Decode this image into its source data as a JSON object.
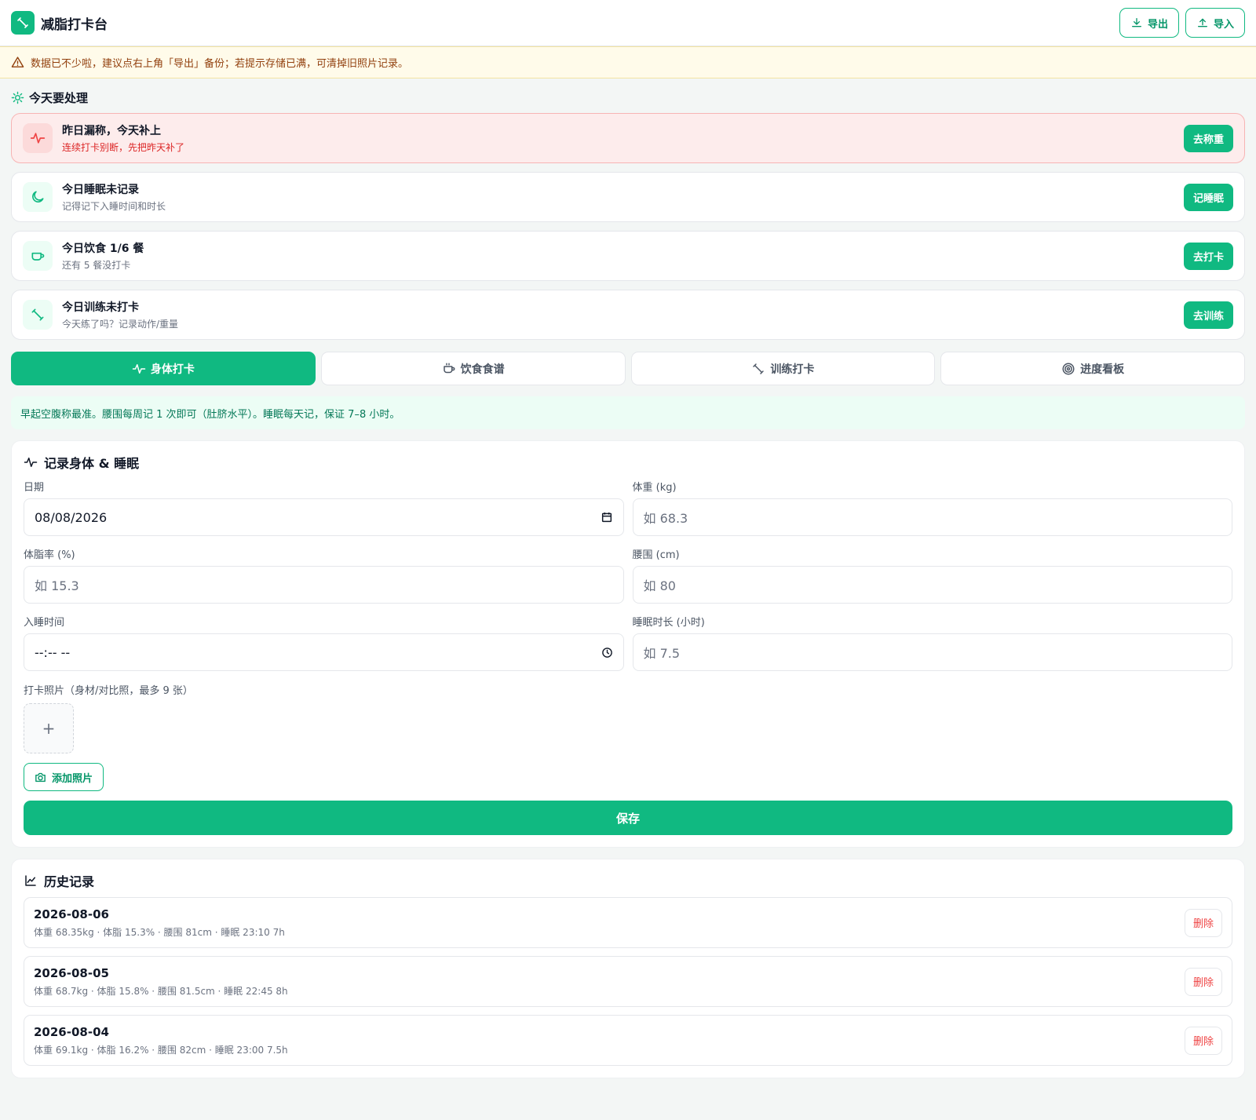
{
  "app": {
    "title": "减脂打卡台",
    "export_label": "导出",
    "import_label": "导入"
  },
  "banner": {
    "text": "数据已不少啦，建议点右上角「导出」备份；若提示存储已满，可清掉旧照片记录。"
  },
  "today": {
    "heading": "今天要处理",
    "items": [
      {
        "title": "昨日漏称，今天补上",
        "sub": "连续打卡别断，先把昨天补了",
        "button": "去称重",
        "icon": "pulse-icon",
        "alert": true
      },
      {
        "title": "今日睡眠未记录",
        "sub": "记得记下入睡时间和时长",
        "button": "记睡眠",
        "icon": "moon-icon",
        "alert": false
      },
      {
        "title": "今日饮食 1/6 餐",
        "sub": "还有 5 餐没打卡",
        "button": "去打卡",
        "icon": "cup-icon",
        "alert": false
      },
      {
        "title": "今日训练未打卡",
        "sub": "今天练了吗？记录动作/重量",
        "button": "去训练",
        "icon": "dumbbell-icon",
        "alert": false
      }
    ]
  },
  "tabs": [
    {
      "label": "身体打卡",
      "icon": "pulse-icon",
      "active": true
    },
    {
      "label": "饮食食谱",
      "icon": "cup-icon",
      "active": false
    },
    {
      "label": "训练打卡",
      "icon": "dumbbell-icon",
      "active": false
    },
    {
      "label": "进度看板",
      "icon": "target-icon",
      "active": false
    }
  ],
  "tip": "早起空腹称最准。腰围每周记 1 次即可（肚脐水平）。睡眠每天记，保证 7–8 小时。",
  "form": {
    "heading": "记录身体 & 睡眠",
    "date_label": "日期",
    "date_value": "08/08/2026",
    "weight_label": "体重 (kg)",
    "weight_placeholder": "如 68.3",
    "bodyfat_label": "体脂率 (%)",
    "bodyfat_placeholder": "如 15.3",
    "waist_label": "腰围 (cm)",
    "waist_placeholder": "如 80",
    "sleep_time_label": "入睡时间",
    "sleep_time_value": "--:-- --",
    "sleep_hours_label": "睡眠时长 (小时)",
    "sleep_hours_placeholder": "如 7.5",
    "photo_label": "打卡照片（身材/对比照，最多 9 张）",
    "photo_add_symbol": "+",
    "add_photo_label": "添加照片",
    "save_label": "保存"
  },
  "history": {
    "heading": "历史记录",
    "delete_label": "删除",
    "rows": [
      {
        "date": "2026-08-06",
        "detail": "体重 68.35kg · 体脂 15.3% · 腰围 81cm · 睡眠 23:10 7h"
      },
      {
        "date": "2026-08-05",
        "detail": "体重 68.7kg · 体脂 15.8% · 腰围 81.5cm · 睡眠 22:45 8h"
      },
      {
        "date": "2026-08-04",
        "detail": "体重 69.1kg · 体脂 16.2% · 腰围 82cm · 睡眠 23:00 7.5h"
      }
    ]
  },
  "colors": {
    "accent": "#10b981",
    "alert": "#ef4444",
    "warn": "#92400e"
  }
}
